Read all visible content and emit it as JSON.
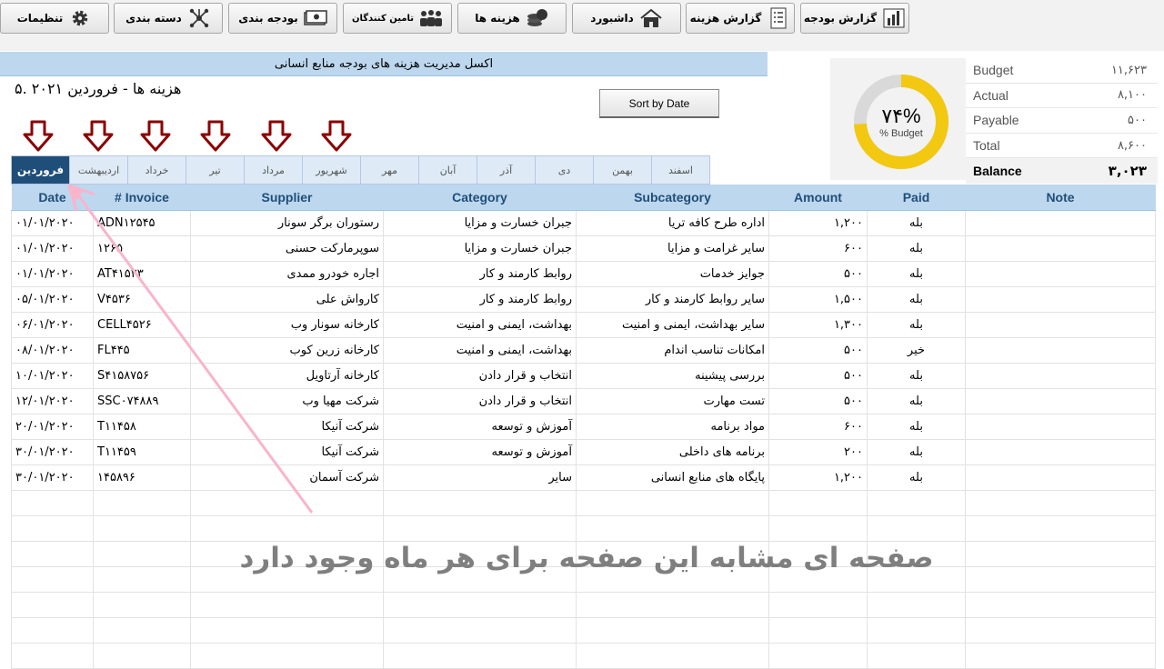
{
  "toolbar": {
    "budget_report": "گزارش بودجه",
    "expense_report": "گزارش هزینه",
    "dashboard": "داشبورد",
    "expenses": "هزینه ها",
    "suppliers": "تامین کنندگان",
    "budgeting": "بودجه بندی",
    "categories": "دسته بندی",
    "settings": "تنظیمات"
  },
  "title": "اکسل مدیریت هزینه های بودجه منابع انسانی",
  "heading": "هزینه ها - فروردین ۲۰۲۱ .۵",
  "sort_button": "Sort by Date",
  "months": [
    "فروردین",
    "اردیبهشت",
    "خرداد",
    "تیر",
    "مرداد",
    "شهریور",
    "مهر",
    "آبان",
    "آذر",
    "دی",
    "بهمن",
    "اسفند"
  ],
  "summary": {
    "donut_percent": 74,
    "donut_text": "۷۴%",
    "donut_label": "% Budget",
    "rows": [
      {
        "label": "Budget",
        "value": "۱۱,۶۲۳"
      },
      {
        "label": "Actual",
        "value": "۸,۱۰۰"
      },
      {
        "label": "Payable",
        "value": "۵۰۰"
      },
      {
        "label": "Total",
        "value": "۸,۶۰۰"
      },
      {
        "label": "Balance",
        "value": "۳,۰۲۳"
      }
    ],
    "colors": {
      "ring": "#f2c811",
      "track": "#d9d9d9"
    }
  },
  "columns": [
    "Date",
    "# Invoice",
    "Supplier",
    "Category",
    "Subcategory",
    "Amount",
    "Paid",
    "Note"
  ],
  "rows": [
    [
      "۰۱/۰۱/۲۰۲۰",
      "ADN۱۲۵۴۵",
      "رستوران برگر سونار",
      "جبران خسارت و مزایا",
      "اداره طرح کافه تریا",
      "۱,۲۰۰",
      "بله",
      ""
    ],
    [
      "۰۱/۰۱/۲۰۲۰",
      "۱۲۶۵",
      "سوپرمارکت حسنی",
      "جبران خسارت و مزایا",
      "سایر غرامت و مزایا",
      "۶۰۰",
      "بله",
      ""
    ],
    [
      "۰۱/۰۱/۲۰۲۰",
      "AT۴۱۵۲۳",
      "اجاره خودرو ممدی",
      "روابط کارمند و کار",
      "جوایز خدمات",
      "۵۰۰",
      "بله",
      ""
    ],
    [
      "۰۵/۰۱/۲۰۲۰",
      "V۴۵۳۶",
      "کارواش علی",
      "روابط کارمند و کار",
      "سایر روابط کارمند و کار",
      "۱,۵۰۰",
      "بله",
      ""
    ],
    [
      "۰۶/۰۱/۲۰۲۰",
      "CELL۴۵۲۶",
      "کارخانه سونار وب",
      "بهداشت، ایمنی و امنیت",
      "سایر بهداشت، ایمنی و امنیت",
      "۱,۳۰۰",
      "بله",
      ""
    ],
    [
      "۰۸/۰۱/۲۰۲۰",
      "FL۴۴۵",
      "کارخانه زرین کوب",
      "بهداشت، ایمنی و امنیت",
      "امکانات تناسب اندام",
      "۵۰۰",
      "خیر",
      ""
    ],
    [
      "۱۰/۰۱/۲۰۲۰",
      "S۴۱۵۸۷۵۶",
      "کارخانه آرتاویل",
      "انتخاب و قرار دادن",
      "بررسی پیشینه",
      "۵۰۰",
      "بله",
      ""
    ],
    [
      "۱۲/۰۱/۲۰۲۰",
      "SSC۰۷۴۸۸۹",
      "شرکت مهیا وب",
      "انتخاب و قرار دادن",
      "تست مهارت",
      "۵۰۰",
      "بله",
      ""
    ],
    [
      "۲۰/۰۱/۲۰۲۰",
      "T۱۱۴۵۸",
      "شرکت آنیکا",
      "آموزش و توسعه",
      "مواد برنامه",
      "۶۰۰",
      "بله",
      ""
    ],
    [
      "۳۰/۰۱/۲۰۲۰",
      "T۱۱۴۵۹",
      "شرکت آنیکا",
      "آموزش و توسعه",
      "برنامه های داخلی",
      "۲۰۰",
      "بله",
      ""
    ],
    [
      "۳۰/۰۱/۲۰۲۰",
      "۱۴۵۸۹۶",
      "شرکت آسمان",
      "سایر",
      "پایگاه های منابع انسانی",
      "۱,۲۰۰",
      "بله",
      ""
    ]
  ],
  "overlay_note": "صفحه ای مشابه این صفحه برای هر ماه وجود دارد"
}
